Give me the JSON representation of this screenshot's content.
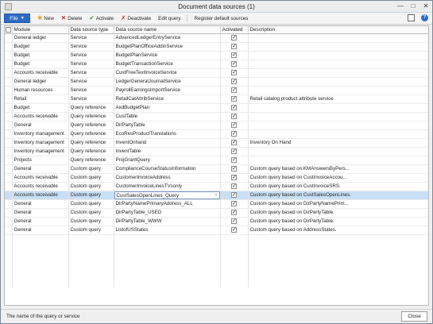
{
  "window": {
    "title": "Document data sources (1)"
  },
  "toolbar": {
    "file_label": "File",
    "new_label": "New",
    "delete_label": "Delete",
    "activate_label": "Activate",
    "deactivate_label": "Deactivate",
    "edit_query_label": "Edit query",
    "register_label": "Register default sources"
  },
  "grid": {
    "columns": [
      "Module",
      "Data source type",
      "Data source name",
      "Activated",
      "Description"
    ],
    "rows": [
      {
        "module": "General ledger",
        "type": "Service",
        "name": "AdvancedLedgerEntryService",
        "activated": true,
        "description": ""
      },
      {
        "module": "Budget",
        "type": "Service",
        "name": "BudgetPlanOfficeAddinService",
        "activated": true,
        "description": ""
      },
      {
        "module": "Budget",
        "type": "Service",
        "name": "BudgetPlanService",
        "activated": true,
        "description": ""
      },
      {
        "module": "Budget",
        "type": "Service",
        "name": "BudgetTransactionService",
        "activated": true,
        "description": ""
      },
      {
        "module": "Accounts receivable",
        "type": "Service",
        "name": "CustFreeTextInvoiceService",
        "activated": true,
        "description": ""
      },
      {
        "module": "General ledger",
        "type": "Service",
        "name": "LedgerGeneralJournalService",
        "activated": true,
        "description": ""
      },
      {
        "module": "Human resources",
        "type": "Service",
        "name": "PayrollEarningsImportService",
        "activated": true,
        "description": ""
      },
      {
        "module": "Retail",
        "type": "Service",
        "name": "RetailCatAttribService",
        "activated": true,
        "description": "Retail catalog product attribute service"
      },
      {
        "module": "Budget",
        "type": "Query reference",
        "name": "AxdBudgetPlan",
        "activated": true,
        "description": ""
      },
      {
        "module": "Accounts receivable",
        "type": "Query reference",
        "name": "CustTable",
        "activated": true,
        "description": ""
      },
      {
        "module": "General",
        "type": "Query reference",
        "name": "DirPartyTable",
        "activated": true,
        "description": ""
      },
      {
        "module": "Inventory management",
        "type": "Query reference",
        "name": "EcoResProductTranslations",
        "activated": true,
        "description": ""
      },
      {
        "module": "Inventory management",
        "type": "Query reference",
        "name": "InventOnhand",
        "activated": true,
        "description": "Inventory On Hand"
      },
      {
        "module": "Inventory management",
        "type": "Query reference",
        "name": "InventTable",
        "activated": true,
        "description": ""
      },
      {
        "module": "Projects",
        "type": "Query reference",
        "name": "ProjGrantQuery",
        "activated": true,
        "description": ""
      },
      {
        "module": "General",
        "type": "Custom query",
        "name": "ComplianceCourseStatusInformation",
        "activated": true,
        "description": "Custom query based on KMAnswersByPers..."
      },
      {
        "module": "Accounts receivable",
        "type": "Custom query",
        "name": "CustomerInvoiceAddress",
        "activated": true,
        "description": "Custom query based on CustInvoiceAccou..."
      },
      {
        "module": "Accounts receivable",
        "type": "Custom query",
        "name": "CustomerInvoiceLinesTVsonly",
        "activated": true,
        "description": "Custom query based on CustInvoiceSRS."
      },
      {
        "module": "Accounts receivable",
        "type": "Custom query",
        "name": "CustSalesOpenLines_Query",
        "activated": true,
        "description": "Custom query based on CustSalesOpenLines.",
        "selected": true
      },
      {
        "module": "General",
        "type": "Custom query",
        "name": "DirPartyNamePrimaryAddress_ALL",
        "activated": true,
        "description": "Custom query based on DirPartyNamePrim..."
      },
      {
        "module": "General",
        "type": "Custom query",
        "name": "DirPartyTable_USED",
        "activated": true,
        "description": "Custom query based on DirPartyTable."
      },
      {
        "module": "General",
        "type": "Custom query",
        "name": "DirPartyTable_WWW",
        "activated": true,
        "description": "Custom query based on DirPartyTable."
      },
      {
        "module": "General",
        "type": "Custom query",
        "name": "ListofUSStates",
        "activated": true,
        "description": "Custom query based on AddressStates."
      }
    ]
  },
  "status": {
    "text": "The name of the query or service",
    "close_label": "Close"
  }
}
